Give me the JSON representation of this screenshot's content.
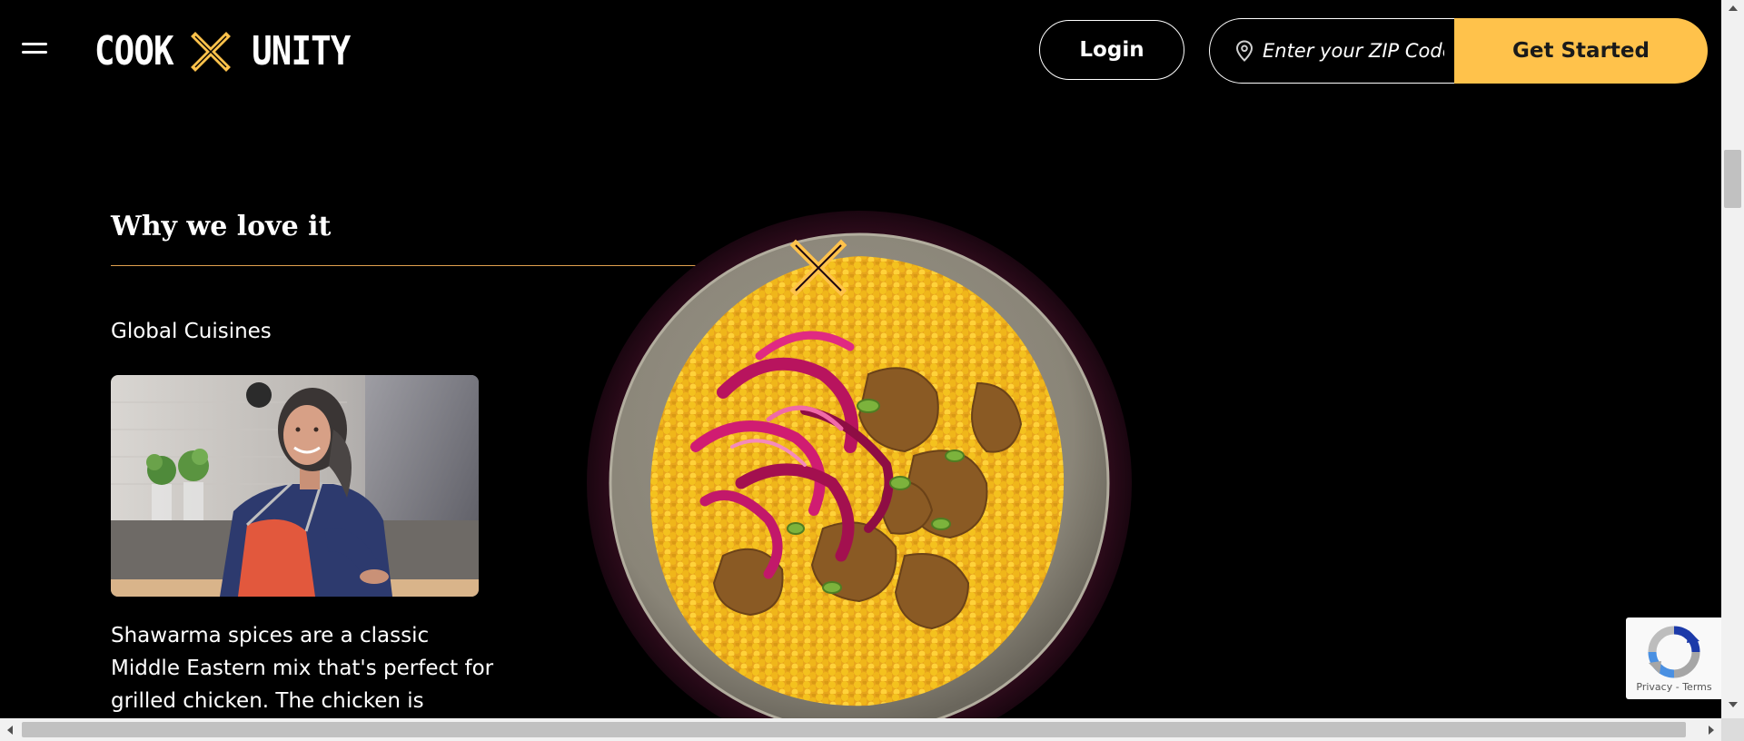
{
  "header": {
    "menu_icon": "hamburger-menu-icon",
    "logo": {
      "left": "COOK",
      "right": "UNITY",
      "mark_color": "#ffc24b"
    },
    "login_label": "Login",
    "zip": {
      "placeholder": "Enter your ZIP Code",
      "icon": "location-pin-icon"
    },
    "get_started_label": "Get Started"
  },
  "section": {
    "title": "Why we love it",
    "cuisine_label": "Global Cuisines",
    "chef_photo": "chef-portrait-photo",
    "description": "Shawarma spices are a classic Middle Eastern mix that's perfect for grilled chicken. The chicken is accompanied",
    "dish_image": "shawarma-chicken-couscous-plate-photo"
  },
  "recaptcha": {
    "privacy": "Privacy",
    "separator": "-",
    "terms": "Terms"
  },
  "colors": {
    "background": "#000000",
    "accent": "#ffc24b",
    "rule": "#e0a04e",
    "plate_halo": "#3a0e22"
  }
}
